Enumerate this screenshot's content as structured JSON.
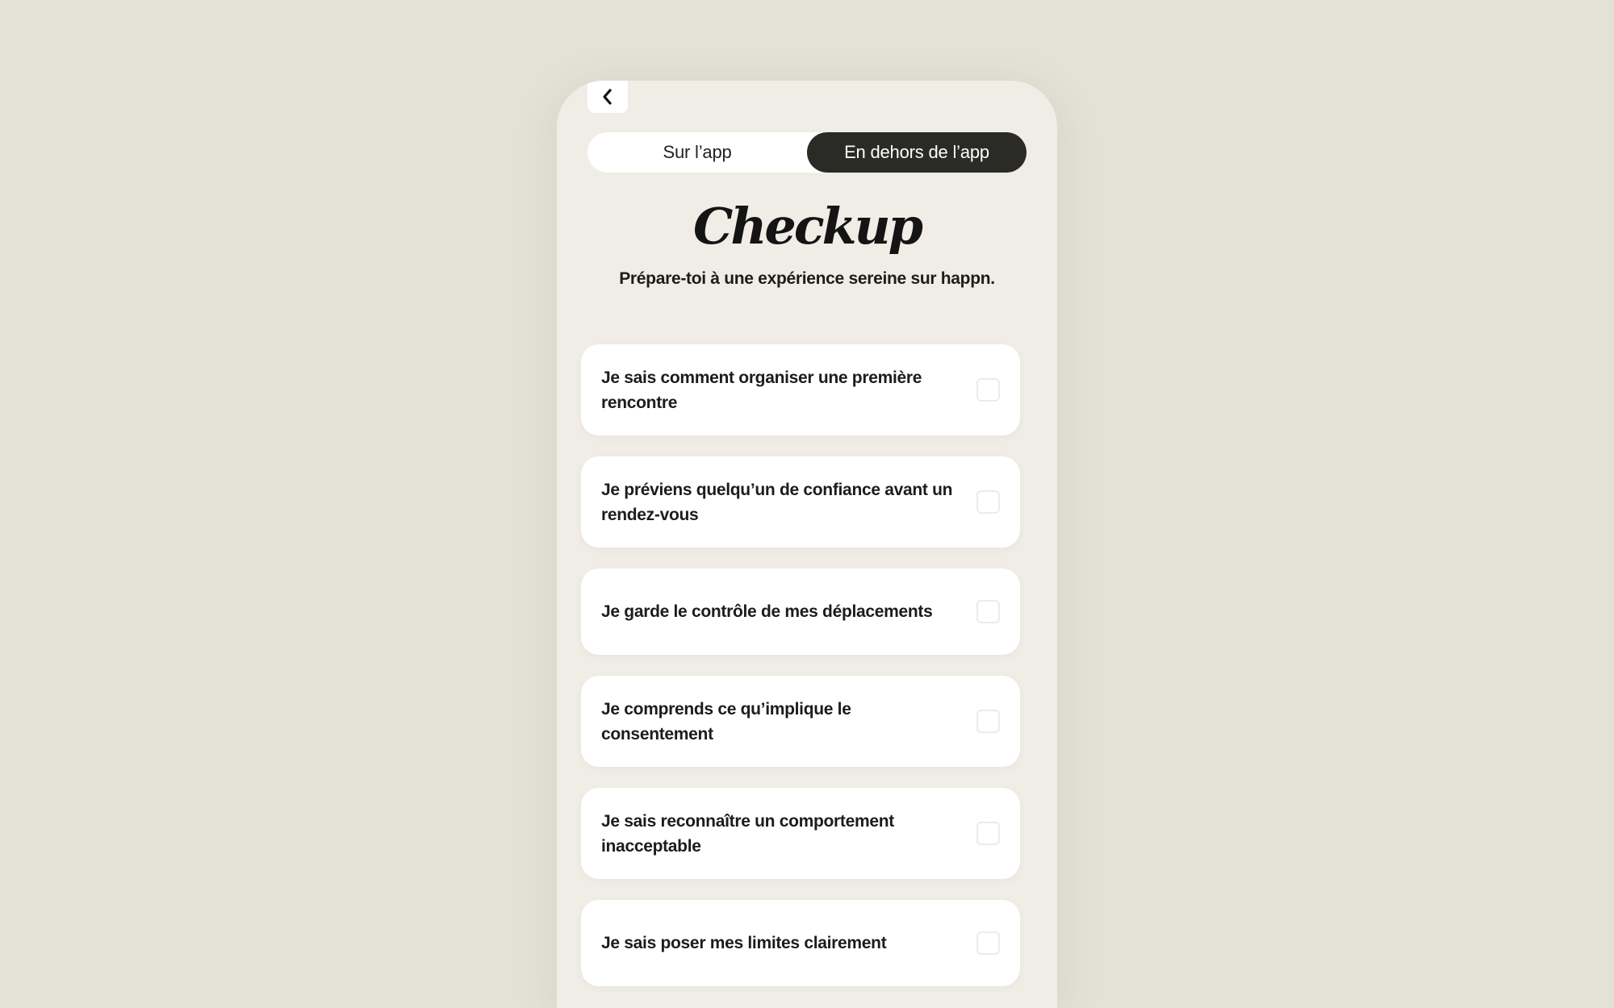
{
  "header": {
    "back_icon": "chevron-left-icon"
  },
  "tabs": [
    {
      "label": "Sur l’app",
      "active": false
    },
    {
      "label": "En dehors de l’app",
      "active": true
    }
  ],
  "title": "Checkup",
  "subtitle": "Prépare-toi à une expérience sereine sur happn.",
  "checklist": [
    {
      "label": "Je sais comment organiser une première rencontre",
      "checked": false
    },
    {
      "label": "Je préviens quelqu’un de confiance avant un rendez-vous",
      "checked": false
    },
    {
      "label": "Je garde le contrôle de mes déplacements",
      "checked": false
    },
    {
      "label": "Je comprends ce qu’implique le consentement",
      "checked": false
    },
    {
      "label": "Je sais reconnaître un comportement inacceptable",
      "checked": false
    },
    {
      "label": "Je sais poser mes limites clairement",
      "checked": false
    }
  ],
  "colors": {
    "page_background": "#e4e1d6",
    "screen_background": "#f0ede6",
    "active_tab": "#2a2a27",
    "card": "#ffffff",
    "text": "#1c1c1a"
  }
}
